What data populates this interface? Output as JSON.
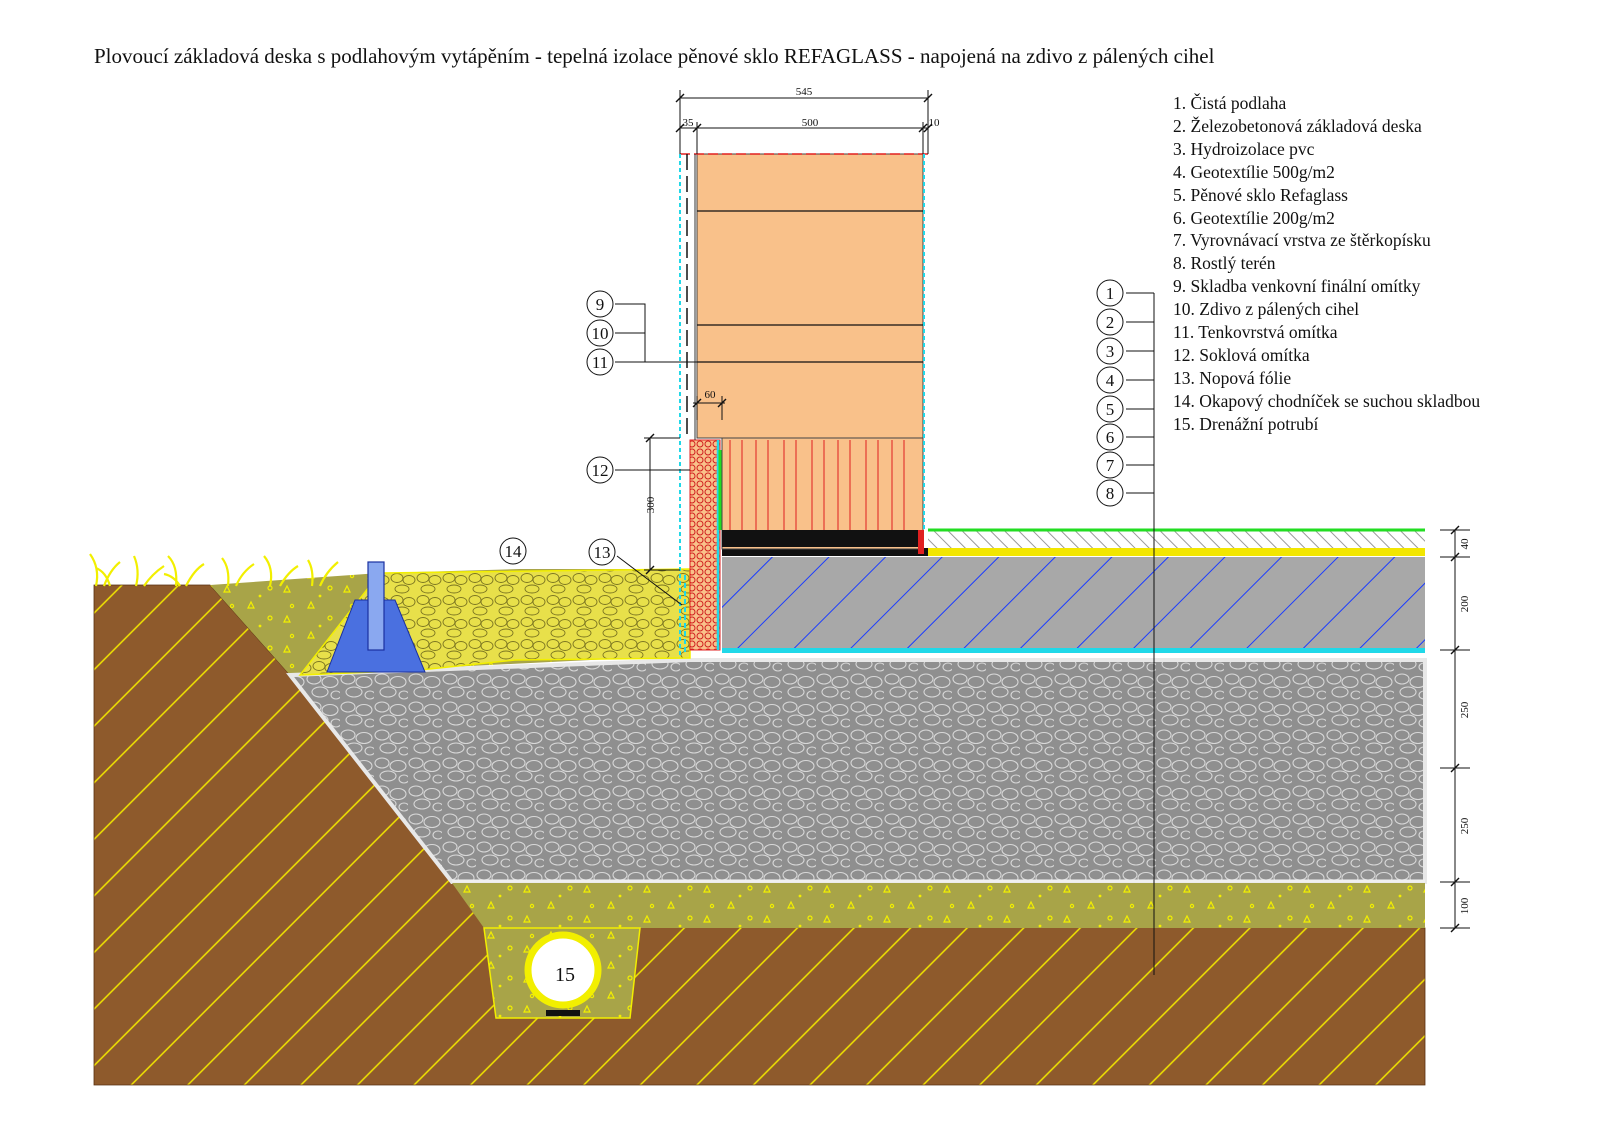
{
  "title": "Plovoucí základová deska s podlahovým vytápěním - tepelná izolace pěnové sklo REFAGLASS - napojená na zdivo z pálených cihel",
  "legend": [
    "1. Čistá podlaha",
    "2. Železobetonová základová deska",
    "3. Hydroizolace pvc",
    "4. Geotextílie 500g/m2",
    "5. Pěnové sklo Refaglass",
    "6. Geotextílie 200g/m2",
    "7. Vyrovnávací vrstva ze štěrkopísku",
    "8. Rostlý terén",
    "9. Skladba venkovní finální omítky",
    "10. Zdivo z pálených cihel",
    "11. Tenkovrstvá omítka",
    "12. Soklová omítka",
    "13. Nopová fólie",
    "14. Okapový chodníček se suchou skladbou",
    "15. Drenážní potrubí"
  ],
  "dimensions": {
    "wall_total": "545",
    "outer": "35",
    "brick": "500",
    "inner": "10",
    "sokl_depth": "60",
    "sokl_height": "300",
    "floor": "40",
    "slab": "200",
    "glass_upper": "250",
    "glass_lower": "250",
    "levelling": "100"
  },
  "callouts": {
    "c1": "1",
    "c2": "2",
    "c3": "3",
    "c4": "4",
    "c5": "5",
    "c6": "6",
    "c7": "7",
    "c8": "8",
    "c9": "9",
    "c10": "10",
    "c11": "11",
    "c12": "12",
    "c13": "13",
    "c14": "14",
    "c15": "15"
  },
  "colors": {
    "soil": "#8e5a2c",
    "hatch_yellow": "#f2e600",
    "foam_glass": "#9a9a9a",
    "concrete": "#a8a8a8",
    "brick": "#f9c18a",
    "gravel_yellow": "#e8e04a",
    "olive": "#a8a448",
    "hydro_cyan": "#20d8e8",
    "green_line": "#22dd22",
    "red_line": "#e02020"
  }
}
